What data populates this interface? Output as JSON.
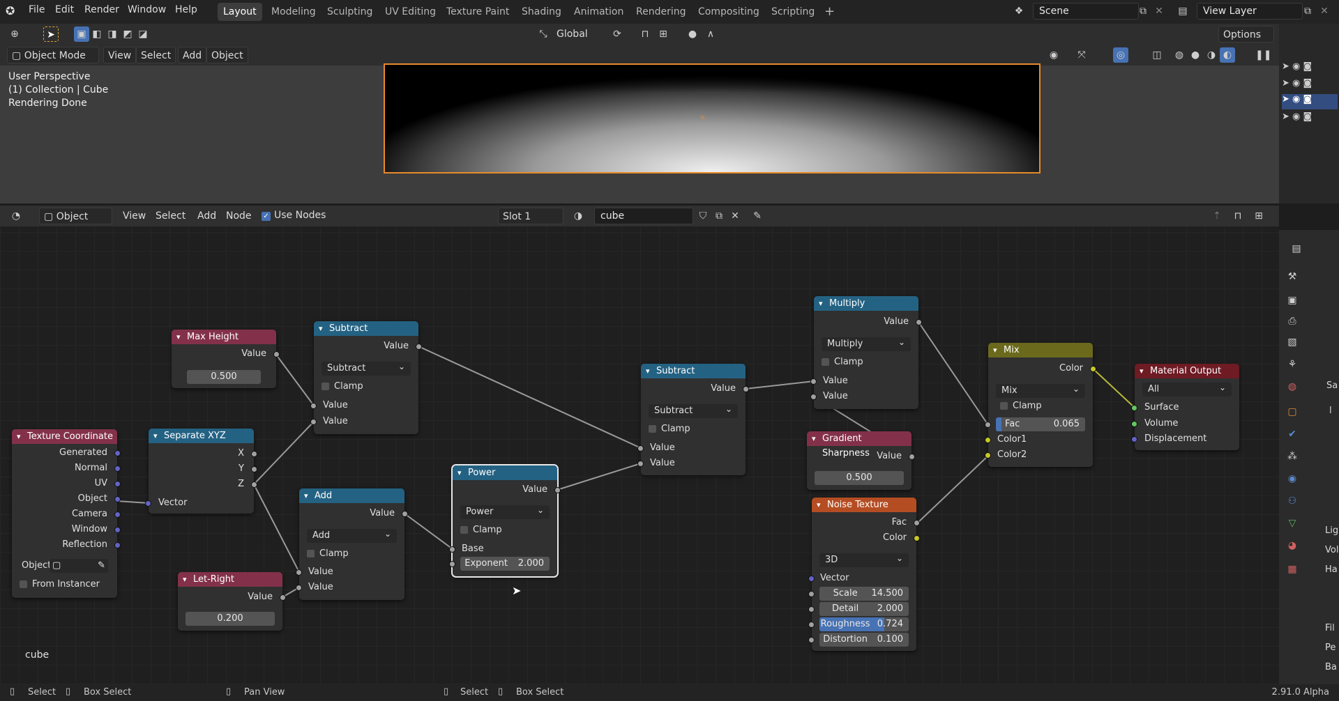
{
  "topbar": {
    "menus": [
      "File",
      "Edit",
      "Render",
      "Window",
      "Help"
    ],
    "workspaces": [
      "Layout",
      "Modeling",
      "Sculpting",
      "UV Editing",
      "Texture Paint",
      "Shading",
      "Animation",
      "Rendering",
      "Compositing",
      "Scripting"
    ],
    "active_workspace": "Layout",
    "add_workspace": "+",
    "scene_name": "Scene",
    "view_layer": "View Layer"
  },
  "viewport": {
    "transform_orientation": "Global",
    "options_label": "Options",
    "mode": "Object Mode",
    "menus": [
      "View",
      "Select",
      "Add",
      "Object"
    ],
    "overlay_lines": [
      "User Perspective",
      "(1) Collection | Cube",
      "Rendering Done"
    ]
  },
  "node_editor": {
    "editor_type": "Object",
    "menus": [
      "View",
      "Select",
      "Add",
      "Node"
    ],
    "use_nodes_label": "Use Nodes",
    "slot": "Slot 1",
    "material_name": "cube",
    "footer_label": "cube"
  },
  "nodes": {
    "max_height": {
      "title": "Max Height",
      "out": "Value",
      "value": "0.500"
    },
    "subtract1": {
      "title": "Subtract",
      "out": "Value",
      "op": "Subtract",
      "clamp": "Clamp",
      "in1": "Value",
      "in2": "Value"
    },
    "tex_coord": {
      "title": "Texture Coordinate",
      "outs": [
        "Generated",
        "Normal",
        "UV",
        "Object",
        "Camera",
        "Window",
        "Reflection"
      ],
      "object_label": "Object:",
      "from_instancer": "From Instancer"
    },
    "sep_xyz": {
      "title": "Separate XYZ",
      "outs": [
        "X",
        "Y",
        "Z"
      ],
      "in": "Vector"
    },
    "add": {
      "title": "Add",
      "out": "Value",
      "op": "Add",
      "clamp": "Clamp",
      "in1": "Value",
      "in2": "Value"
    },
    "let_right": {
      "title": "Let-Right",
      "out": "Value",
      "value": "0.200"
    },
    "power": {
      "title": "Power",
      "out": "Value",
      "op": "Power",
      "clamp": "Clamp",
      "base": "Base",
      "exp_label": "Exponent",
      "exp_value": "2.000"
    },
    "subtract2": {
      "title": "Subtract",
      "out": "Value",
      "op": "Subtract",
      "clamp": "Clamp",
      "in1": "Value",
      "in2": "Value"
    },
    "multiply": {
      "title": "Multiply",
      "out": "Value",
      "op": "Multiply",
      "clamp": "Clamp",
      "in1": "Value",
      "in2": "Value"
    },
    "grad_sharp": {
      "title": "Gradient Sharpness",
      "out": "Value",
      "value": "0.500"
    },
    "noise": {
      "title": "Noise Texture",
      "out_fac": "Fac",
      "out_color": "Color",
      "dim": "3D",
      "in_vec": "Vector",
      "scale_l": "Scale",
      "scale_v": "14.500",
      "detail_l": "Detail",
      "detail_v": "2.000",
      "rough_l": "Roughness",
      "rough_v": "0.724",
      "rough_fraction": 0.724,
      "dist_l": "Distortion",
      "dist_v": "0.100"
    },
    "mix": {
      "title": "Mix",
      "out": "Color",
      "blend": "Mix",
      "clamp": "Clamp",
      "fac_l": "Fac",
      "fac_v": "0.065",
      "fac_fraction": 0.065,
      "c1": "Color1",
      "c2": "Color2"
    },
    "mat_out": {
      "title": "Material Output",
      "target": "All",
      "surface": "Surface",
      "volume": "Volume",
      "displacement": "Displacement"
    }
  },
  "sidebar_labels": [
    "Sa",
    "l",
    "Lig",
    "Vol",
    "Ha",
    "Fil",
    "Pe",
    "Ba"
  ],
  "statusbar": {
    "items": [
      "Select",
      "Box Select",
      "Pan View",
      "Select",
      "Box Select"
    ],
    "version": "2.91.0 Alpha"
  }
}
